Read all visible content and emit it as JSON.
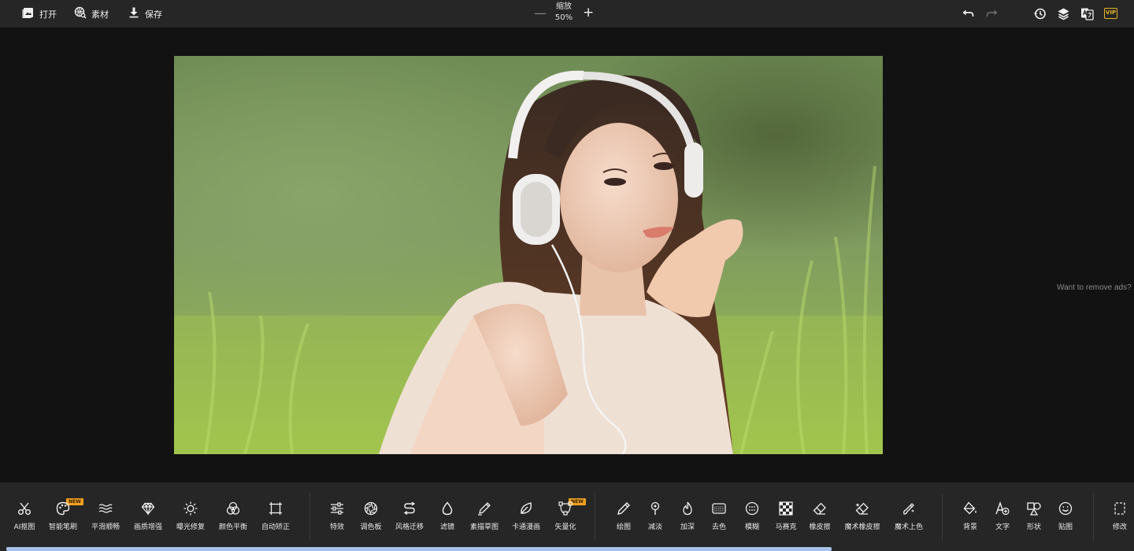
{
  "topbar": {
    "open_label": "打开",
    "assets_label": "素材",
    "save_label": "保存",
    "zoom_label": "缩放",
    "zoom_value": "50%",
    "zoom_minus": "—",
    "zoom_plus": "+",
    "vip_label": "VIP"
  },
  "canvas": {
    "ads_text": "Want to remove ads?"
  },
  "tools": {
    "g1": [
      {
        "label": "AI抠图",
        "icon": "scissors-icon"
      },
      {
        "label": "智能笔刷",
        "icon": "palette-icon",
        "new": "NEW"
      },
      {
        "label": "平滑顺畅",
        "icon": "waves-icon"
      },
      {
        "label": "画质增强",
        "icon": "diamond-icon"
      },
      {
        "label": "曝光修复",
        "icon": "sun-icon"
      },
      {
        "label": "颜色平衡",
        "icon": "color-balance-icon"
      },
      {
        "label": "自动矫正",
        "icon": "crop-correct-icon"
      }
    ],
    "g2": [
      {
        "label": "特效",
        "icon": "sliders-icon"
      },
      {
        "label": "调色板",
        "icon": "aperture-icon"
      },
      {
        "label": "风格迁移",
        "icon": "style-transfer-icon"
      },
      {
        "label": "滤镜",
        "icon": "drop-icon"
      },
      {
        "label": "素描草图",
        "icon": "pencil-sketch-icon"
      },
      {
        "label": "卡通漫画",
        "icon": "leaf-icon"
      },
      {
        "label": "矢量化",
        "icon": "vector-icon",
        "new": "NEW"
      }
    ],
    "g3": [
      {
        "label": "绘图",
        "icon": "pen-icon"
      },
      {
        "label": "减淡",
        "icon": "dodge-icon"
      },
      {
        "label": "加深",
        "icon": "flame-icon"
      },
      {
        "label": "去色",
        "icon": "desaturate-icon"
      },
      {
        "label": "模糊",
        "icon": "blur-icon"
      },
      {
        "label": "马赛克",
        "icon": "mosaic-icon"
      },
      {
        "label": "橡皮擦",
        "icon": "eraser-icon"
      },
      {
        "label": "魔术橡皮擦",
        "icon": "magic-eraser-icon"
      },
      {
        "label": "魔术上色",
        "icon": "magic-brush-icon"
      }
    ],
    "g4": [
      {
        "label": "背景",
        "icon": "paint-bucket-icon"
      },
      {
        "label": "文字",
        "icon": "text-add-icon"
      },
      {
        "label": "形状",
        "icon": "shapes-icon"
      },
      {
        "label": "贴图",
        "icon": "smiley-icon"
      }
    ],
    "g5": [
      {
        "label": "修改",
        "icon": "resize-icon"
      }
    ]
  }
}
